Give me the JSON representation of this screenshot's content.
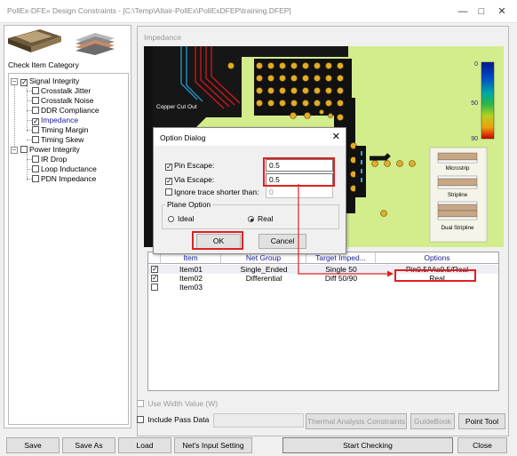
{
  "window": {
    "title": "PollEx-DFE» Design Constraints - [C:\\Temp\\Altair-PollEx\\PollExDFEP\\training.DFEP]"
  },
  "left": {
    "category_label": "Check Item Category",
    "tree": [
      {
        "label": "Signal Integrity",
        "checked": true,
        "expanded": true,
        "level": 0
      },
      {
        "label": "Crosstalk Jitter",
        "checked": false,
        "level": 1
      },
      {
        "label": "Crosstalk Noise",
        "checked": false,
        "level": 1
      },
      {
        "label": "DDR Compliance",
        "checked": false,
        "level": 1
      },
      {
        "label": "Impedance",
        "checked": true,
        "selected": true,
        "level": 1
      },
      {
        "label": "Timing Margin",
        "checked": false,
        "level": 1
      },
      {
        "label": "Timing Skew",
        "checked": false,
        "level": 1
      },
      {
        "label": "Power Integrity",
        "checked": false,
        "expanded": true,
        "level": 0
      },
      {
        "label": "IR Drop",
        "checked": false,
        "level": 1
      },
      {
        "label": "Loop Inductance",
        "checked": false,
        "level": 1
      },
      {
        "label": "PDN Impedance",
        "checked": false,
        "level": 1
      }
    ]
  },
  "main": {
    "group_label": "Impedance",
    "image": {
      "copper_cutout_label": "Copper Cut Out",
      "scale_labels": [
        "0",
        "50",
        "90"
      ],
      "legend": [
        "Microstrip",
        "Stripline",
        "Dual Stripline"
      ]
    },
    "table": {
      "headers": [
        "Item",
        "Net Group",
        "Target Imped...",
        "Options"
      ],
      "rows": [
        {
          "checked": true,
          "item": "Item01",
          "net_group": "Single_Ended",
          "target": "Single 50",
          "options": "Pin0.5/Via0.5/Real"
        },
        {
          "checked": true,
          "item": "Item02",
          "net_group": "Differential",
          "target": "Diff 50/90",
          "options": "Real"
        },
        {
          "checked": false,
          "item": "Item03",
          "net_group": "",
          "target": "",
          "options": ""
        }
      ]
    },
    "use_width_value": "Use Width Value (W)",
    "include_pass_data": "Include Pass Data",
    "thermal_button": "Thermal Analysis Constraints",
    "guidebook_button": "GuideBook",
    "point_tool_button": "Point Tool"
  },
  "dialog": {
    "title": "Option Dialog",
    "pin_escape_label": "Pin Escape:",
    "pin_escape_value": "0.5",
    "via_escape_label": "Via Escape:",
    "via_escape_value": "0.5",
    "ignore_label": "Ignore trace shorter than:",
    "ignore_value": "0",
    "plane_group": "Plane Option",
    "ideal_label": "Ideal",
    "real_label": "Real",
    "ok_label": "OK",
    "cancel_label": "Cancel"
  },
  "footer": {
    "save": "Save",
    "save_as": "Save As",
    "load": "Load",
    "nets_input": "Net's Input Setting",
    "start_checking": "Start Checking",
    "close": "Close"
  },
  "colors": {
    "accent_red": "#e02020",
    "board_green": "#d3ec8c",
    "header_blue": "#1a1a9a"
  }
}
